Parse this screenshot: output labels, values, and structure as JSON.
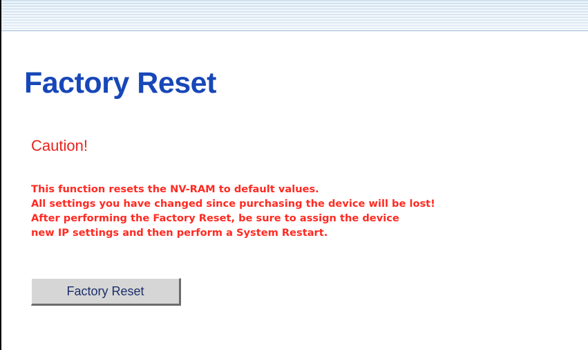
{
  "header": {
    "title": "Factory Reset"
  },
  "caution": {
    "heading": "Caution!",
    "lines": [
      "This function resets the NV-RAM to default values.",
      "All settings you have changed since purchasing the device will be lost!",
      "After performing the Factory Reset, be sure to assign the device",
      "new IP settings and then perform a System Restart."
    ]
  },
  "actions": {
    "factory_reset_label": "Factory Reset"
  },
  "colors": {
    "title": "#1747b8",
    "warning": "#ff2a22",
    "caution_heading": "#e8231d",
    "button_face": "#d6d6d6",
    "banner": "#cfe0ef"
  }
}
